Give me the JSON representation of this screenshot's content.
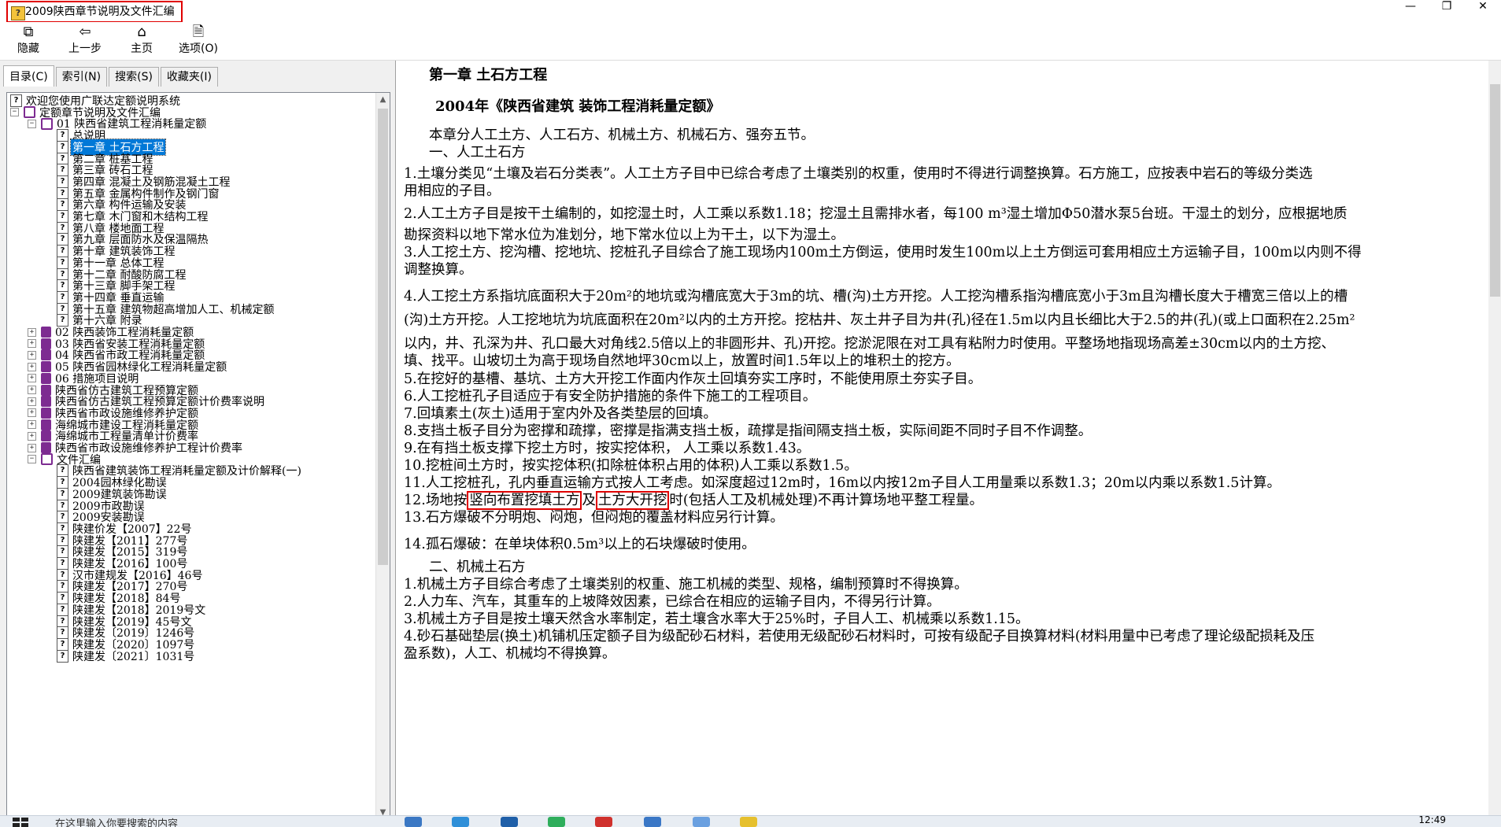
{
  "window": {
    "title": "2009陕西章节说明及文件汇编",
    "app_icon": "?",
    "controls": [
      "—",
      "❐",
      "✕"
    ]
  },
  "toolbar": {
    "buttons": [
      {
        "label": "隐藏",
        "icon": "hide-icon",
        "glyph": "⧉"
      },
      {
        "label": "上一步",
        "icon": "back-arrow-icon",
        "glyph": "⇦"
      },
      {
        "label": "主页",
        "icon": "home-icon",
        "glyph": "⌂"
      },
      {
        "label": "选项(O)",
        "icon": "options-icon",
        "glyph": "🗎"
      }
    ]
  },
  "left_tabs": [
    "目录(C)",
    "索引(N)",
    "搜索(S)",
    "收藏夹(I)"
  ],
  "tree": [
    {
      "label": "欢迎您使用广联达定额说明系统",
      "icon": "q",
      "depth": 0,
      "exp": ""
    },
    {
      "label": "定额章节说明及文件汇编",
      "icon": "bookopen",
      "depth": 0,
      "exp": "−"
    },
    {
      "label": "01 陕西省建筑工程消耗量定额",
      "icon": "bookopen",
      "depth": 1,
      "exp": "−"
    },
    {
      "label": "总说明",
      "icon": "q",
      "depth": 2,
      "exp": ""
    },
    {
      "label": "第一章 土石方工程",
      "icon": "q",
      "depth": 2,
      "exp": "",
      "selected": true
    },
    {
      "label": "第二章 桩基工程",
      "icon": "q",
      "depth": 2,
      "exp": ""
    },
    {
      "label": "第三章 砖石工程",
      "icon": "q",
      "depth": 2,
      "exp": ""
    },
    {
      "label": "第四章 混凝土及钢筋混凝土工程",
      "icon": "q",
      "depth": 2,
      "exp": ""
    },
    {
      "label": "第五章 金属构件制作及钢门窗",
      "icon": "q",
      "depth": 2,
      "exp": ""
    },
    {
      "label": "第六章 构件运输及安装",
      "icon": "q",
      "depth": 2,
      "exp": ""
    },
    {
      "label": "第七章 木门窗和木结构工程",
      "icon": "q",
      "depth": 2,
      "exp": ""
    },
    {
      "label": "第八章 楼地面工程",
      "icon": "q",
      "depth": 2,
      "exp": ""
    },
    {
      "label": "第九章 层面防水及保温隔热",
      "icon": "q",
      "depth": 2,
      "exp": ""
    },
    {
      "label": "第十章 建筑装饰工程",
      "icon": "q",
      "depth": 2,
      "exp": ""
    },
    {
      "label": "第十一章 总体工程",
      "icon": "q",
      "depth": 2,
      "exp": ""
    },
    {
      "label": "第十二章 耐酸防腐工程",
      "icon": "q",
      "depth": 2,
      "exp": ""
    },
    {
      "label": "第十三章 脚手架工程",
      "icon": "q",
      "depth": 2,
      "exp": ""
    },
    {
      "label": "第十四章 垂直运输",
      "icon": "q",
      "depth": 2,
      "exp": ""
    },
    {
      "label": "第十五章 建筑物超高增加人工、机械定额",
      "icon": "q",
      "depth": 2,
      "exp": ""
    },
    {
      "label": "第十六章 附录",
      "icon": "q",
      "depth": 2,
      "exp": ""
    },
    {
      "label": "02 陕西装饰工程消耗量定额",
      "icon": "book",
      "depth": 1,
      "exp": "+"
    },
    {
      "label": "03 陕西省安装工程消耗量定额",
      "icon": "book",
      "depth": 1,
      "exp": "+"
    },
    {
      "label": "04 陕西省市政工程消耗量定额",
      "icon": "book",
      "depth": 1,
      "exp": "+"
    },
    {
      "label": "05 陕西省园林绿化工程消耗量定额",
      "icon": "book",
      "depth": 1,
      "exp": "+"
    },
    {
      "label": "06 措施项目说明",
      "icon": "book",
      "depth": 1,
      "exp": "+"
    },
    {
      "label": "陕西省仿古建筑工程预算定额",
      "icon": "book",
      "depth": 1,
      "exp": "+"
    },
    {
      "label": "陕西省仿古建筑工程预算定额计价费率说明",
      "icon": "book",
      "depth": 1,
      "exp": "+"
    },
    {
      "label": "陕西省市政设施维修养护定额",
      "icon": "book",
      "depth": 1,
      "exp": "+"
    },
    {
      "label": "海绵城市建设工程消耗量定额",
      "icon": "book",
      "depth": 1,
      "exp": "+"
    },
    {
      "label": "海绵城市工程量清单计价费率",
      "icon": "book",
      "depth": 1,
      "exp": "+"
    },
    {
      "label": "陕西省市政设施维修养护工程计价费率",
      "icon": "book",
      "depth": 1,
      "exp": "+"
    },
    {
      "label": "文件汇编",
      "icon": "bookopen",
      "depth": 1,
      "exp": "−"
    },
    {
      "label": "陕西省建筑装饰工程消耗量定额及计价解释(一)",
      "icon": "q",
      "depth": 2,
      "exp": ""
    },
    {
      "label": "2004园林绿化勘误",
      "icon": "q",
      "depth": 2,
      "exp": ""
    },
    {
      "label": "2009建筑装饰勘误",
      "icon": "q",
      "depth": 2,
      "exp": ""
    },
    {
      "label": "2009市政勘误",
      "icon": "q",
      "depth": 2,
      "exp": ""
    },
    {
      "label": "2009安装勘误",
      "icon": "q",
      "depth": 2,
      "exp": ""
    },
    {
      "label": "陕建价发【2007】22号",
      "icon": "q",
      "depth": 2,
      "exp": ""
    },
    {
      "label": "陕建发【2011】277号",
      "icon": "q",
      "depth": 2,
      "exp": ""
    },
    {
      "label": "陕建发【2015】319号",
      "icon": "q",
      "depth": 2,
      "exp": ""
    },
    {
      "label": "陕建发【2016】100号",
      "icon": "q",
      "depth": 2,
      "exp": ""
    },
    {
      "label": "汉市建规发【2016】46号",
      "icon": "q",
      "depth": 2,
      "exp": ""
    },
    {
      "label": "陕建发【2017】270号",
      "icon": "q",
      "depth": 2,
      "exp": ""
    },
    {
      "label": "陕建发【2018】84号",
      "icon": "q",
      "depth": 2,
      "exp": ""
    },
    {
      "label": "陕建发【2018】2019号文",
      "icon": "q",
      "depth": 2,
      "exp": ""
    },
    {
      "label": "陕建发【2019】45号文",
      "icon": "q",
      "depth": 2,
      "exp": ""
    },
    {
      "label": "陕建发〔2019〕1246号",
      "icon": "q",
      "depth": 2,
      "exp": ""
    },
    {
      "label": "陕建发〔2020〕1097号",
      "icon": "q",
      "depth": 2,
      "exp": ""
    },
    {
      "label": "陕建发〔2021〕1031号",
      "icon": "q",
      "depth": 2,
      "exp": ""
    }
  ],
  "doc": {
    "chapter_title": "第一章 土石方工程",
    "subtitle": "2004年《陕西省建筑 装饰工程消耗量定额》",
    "lines": [
      {
        "t": "本章分人工土方、人工石方、机械土方、机械石方、强夯五节。"
      },
      {
        "t": "一、人工土石方"
      },
      {
        "t": "    1.土壤分类见“土壤及岩石分类表”。人工土方子目中已综合考虑了土壤类别的权重，使用时不得进行调整换算。石方施工，应按表中岩石的等级分类选"
      },
      {
        "t": "用相应的子目。"
      },
      {
        "t": "    2.人工土方子目是按干土编制的，如挖湿土时，人工乘以系数1.18；挖湿土且需排水者，每100 m³湿土增加Φ50潜水泵5台班。干湿土的划分，应根据地质"
      },
      {
        "t": "勘探资料以地下常水位为准划分，地下常水位以上为干土，以下为湿土。"
      },
      {
        "t": "    3.人工挖土方、挖沟槽、挖地坑、挖桩孔子目综合了施工现场内100m土方倒运，使用时发生100m以上土方倒运可套用相应土方运输子目，100m以内则不得"
      },
      {
        "t": "调整换算。"
      },
      {
        "t": "    4.人工挖土方系指坑底面积大于20m²的地坑或沟槽底宽大于3m的坑、槽(沟)土方开挖。人工挖沟槽系指沟槽底宽小于3m且沟槽长度大于槽宽三倍以上的槽"
      },
      {
        "t": "(沟)土方开挖。人工挖地坑为坑底面积在20m²以内的土方开挖。挖枯井、灰土井子目为井(孔)径在1.5m以内且长细比大于2.5的井(孔)(或上口面积在2.25m²"
      },
      {
        "t": "以内，井、孔深为井、孔口最大对角线2.5倍以上的非圆形井、孔)开挖。挖淤泥限在对工具有粘附力时使用。平整场地指现场高差±30cm以内的土方挖、"
      },
      {
        "t": "填、找平。山坡切土为高于现场自然地坪30cm以上，放置时间1.5年以上的堆积土的挖方。"
      },
      {
        "t": "    5.在挖好的基槽、基坑、土方大开挖工作面内作灰土回填夯实工序时，不能使用原土夯实子目。"
      },
      {
        "t": "    6.人工挖桩孔子目适应于有安全防护措施的条件下施工的工程项目。"
      },
      {
        "t": "    7.回填素土(灰土)适用于室内外及各类垫层的回填。"
      },
      {
        "t": "    8.支挡土板子目分为密撑和疏撑，密撑是指满支挡土板，疏撑是指间隔支挡土板，实际间距不同时子目不作调整。"
      },
      {
        "t": "    9.在有挡土板支撑下挖土方时，按实挖体积， 人工乘以系数1.43。"
      },
      {
        "t": "    10.挖桩间土方时，按实挖体积(扣除桩体积占用的体积)人工乘以系数1.5。"
      },
      {
        "t": "    11.人工挖桩孔，孔内垂直运输方式按人工考虑。如深度超过12m时，16m以内按12m子目人工用量乘以系数1.3；20m以内乘以系数1.5计算。"
      },
      {
        "t": "    12.场地按",
        "hl1": "竖向布置挖填土方",
        "mid": "及",
        "hl2": "土方大开挖",
        "tail": "时(包括人工及机械处理)不再计算场地平整工程量。"
      },
      {
        "t": "    13.石方爆破不分明炮、闷炮，但闷炮的覆盖材料应另行计算。"
      },
      {
        "t": "    14.孤石爆破：在单块体积0.5m³以上的石块爆破时使用。"
      },
      {
        "t": "二、机械土石方"
      },
      {
        "t": "    1.机械土方子目综合考虑了土壤类别的权重、施工机械的类型、规格，编制预算时不得换算。"
      },
      {
        "t": "    2.人力车、汽车，其重车的上坡降效因素，已综合在相应的运输子目内，不得另行计算。"
      },
      {
        "t": "    3.机械土方子目是按土壤天然含水率制定，若土壤含水率大于25%时，子目人工、机械乘以系数1.15。"
      },
      {
        "t": "    4.砂石基础垫层(换土)机铺机压定额子目为级配砂石材料，若使用无级配砂石材料时，可按有级配子目换算材料(材料用量中已考虑了理论级配损耗及压"
      },
      {
        "t": "盈系数)，人工、机械均不得换算。"
      }
    ]
  },
  "taskbar": {
    "search_placeholder": "在这里输入你要搜索的内容",
    "clock": "12:49"
  }
}
